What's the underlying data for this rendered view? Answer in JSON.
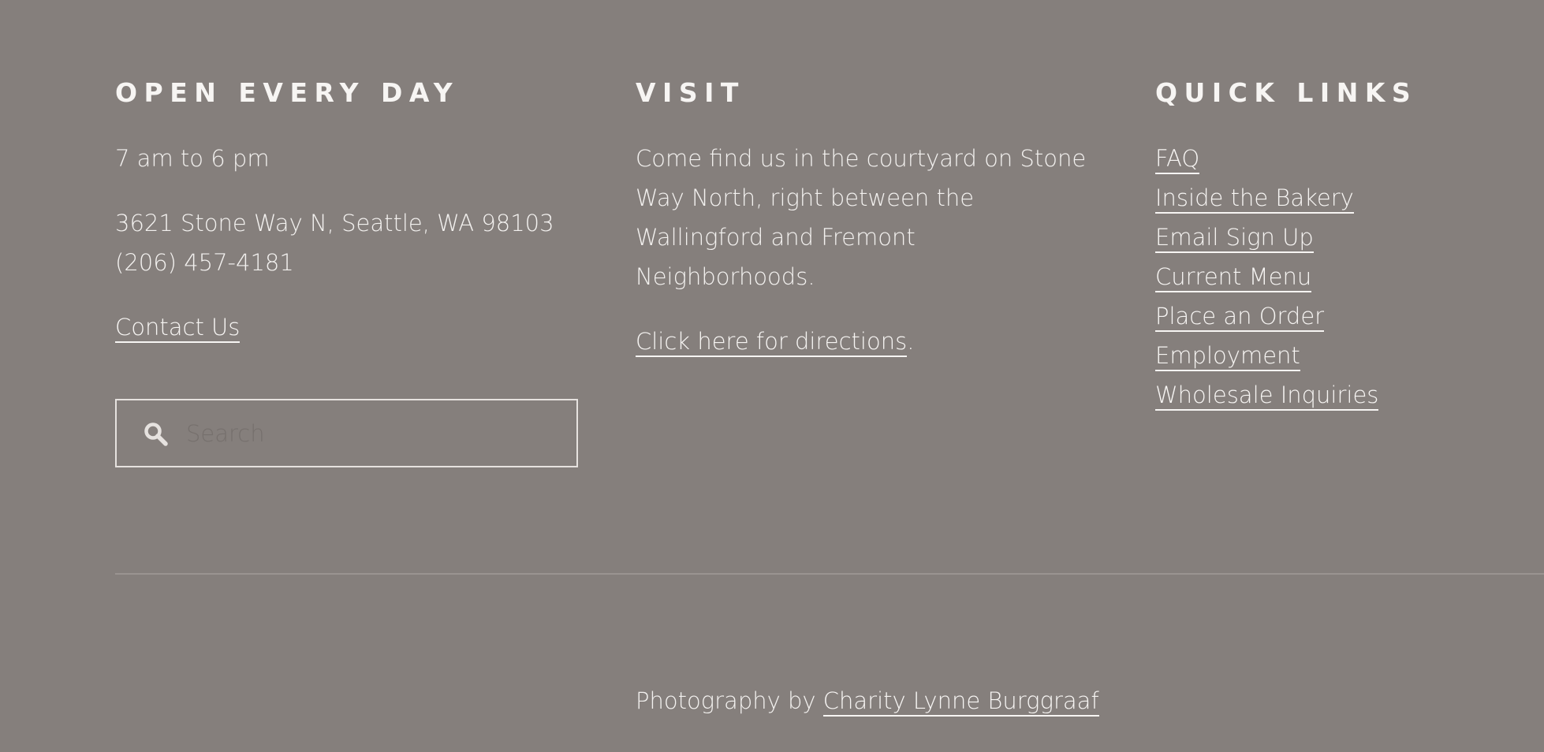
{
  "hours": {
    "heading": "OPEN EVERY DAY",
    "hours_text": "7 am to 6 pm",
    "address": "3621 Stone Way N, Seattle, WA 98103",
    "phone": "(206) 457-4181",
    "contact_link": "Contact Us"
  },
  "search": {
    "placeholder": "Search",
    "value": ""
  },
  "visit": {
    "heading": "VISIT",
    "description_lines": [
      "Come find us in the courtyard on Stone",
      "Way North, right between the",
      "Wallingford and Fremont",
      "Neighborhoods."
    ],
    "directions_link": "Click here for directions",
    "directions_suffix": "."
  },
  "quick_links": {
    "heading": "QUICK LINKS",
    "items": [
      {
        "label": "FAQ"
      },
      {
        "label": "Inside the Bakery"
      },
      {
        "label": "Email Sign Up"
      },
      {
        "label": "Current Menu"
      },
      {
        "label": "Place an Order"
      },
      {
        "label": "Employment"
      },
      {
        "label": "Wholesale Inquiries"
      }
    ]
  },
  "footer": {
    "credit_prefix": "Photography by ",
    "credit_link": "Charity Lynne Burggraaf"
  },
  "colors": {
    "background": "#857f7c",
    "text": "#f3f1ef",
    "divider": "#9a9491"
  },
  "icons": {
    "search": "search-icon"
  }
}
